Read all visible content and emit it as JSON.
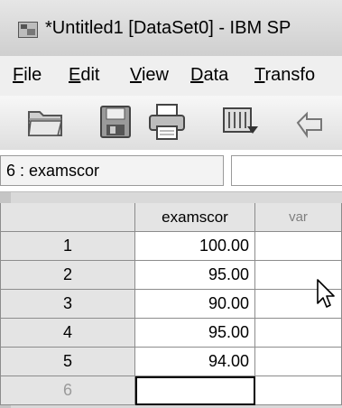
{
  "window": {
    "title": "*Untitled1 [DataSet0] - IBM SP"
  },
  "menu": [
    {
      "mnemonic": "F",
      "rest": "ile"
    },
    {
      "mnemonic": "E",
      "rest": "dit"
    },
    {
      "mnemonic": "V",
      "rest": "iew"
    },
    {
      "mnemonic": "D",
      "rest": "ata"
    },
    {
      "mnemonic": "T",
      "rest": "ransfo"
    }
  ],
  "toolbar": {
    "icons": [
      "open-folder-icon",
      "save-icon",
      "print-icon",
      "dialog-recall-icon",
      "undo-icon"
    ]
  },
  "cell_ref": {
    "value": "6 : examscor"
  },
  "grid": {
    "columns": [
      "examscor",
      "var"
    ],
    "rows": [
      {
        "num": "1",
        "examscor": "100.00"
      },
      {
        "num": "2",
        "examscor": "95.00"
      },
      {
        "num": "3",
        "examscor": "90.00"
      },
      {
        "num": "4",
        "examscor": "95.00"
      },
      {
        "num": "5",
        "examscor": "94.00"
      },
      {
        "num": "6",
        "examscor": ""
      }
    ]
  }
}
